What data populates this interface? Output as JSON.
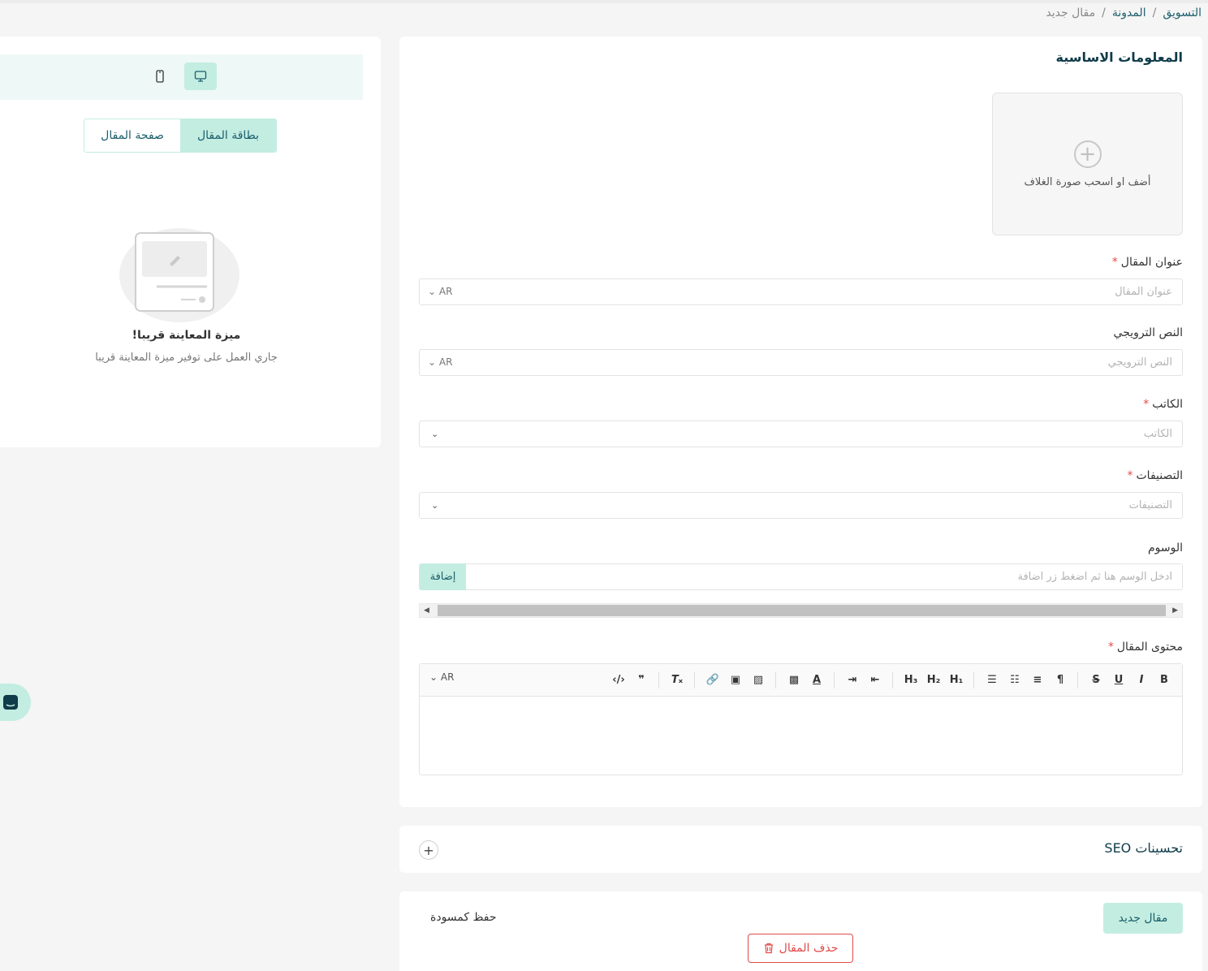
{
  "breadcrumb": {
    "items": [
      "التسويق",
      "المدونة"
    ],
    "separator": "/",
    "current": "مقال جديد"
  },
  "form": {
    "section_title": "المعلومات الاساسية",
    "cover_upload": {
      "label": "أضف او اسحب صورة الغلاف",
      "icon": "plus-circle-icon"
    },
    "title_field": {
      "label": "عنوان المقال",
      "required_mark": "*",
      "placeholder": "عنوان المقال",
      "lang": "AR"
    },
    "promo_field": {
      "label": "النص الترويجي",
      "placeholder": "النص الترويجي",
      "lang": "AR"
    },
    "author_field": {
      "label": "الكاتب",
      "required_mark": "*",
      "placeholder": "الكاتب"
    },
    "categories_field": {
      "label": "التصنيفات",
      "required_mark": "*",
      "placeholder": "التصنيفات"
    },
    "tags_field": {
      "label": "الوسوم",
      "placeholder": "ادخل الوسم هنا ثم اضغط زر اضافة",
      "add_label": "إضافة"
    },
    "content_field": {
      "label": "محتوى المقال",
      "required_mark": "*",
      "lang": "AR",
      "toolbar": [
        "B",
        "I",
        "U",
        "S",
        "¶",
        "≡",
        "1≡",
        "•≡",
        "H1",
        "H2",
        "H3",
        "indent",
        "outdent",
        "A",
        "highlight",
        "image",
        "video",
        "link",
        "Tx",
        "99",
        "</>"
      ]
    }
  },
  "seo": {
    "title": "تحسينات SEO",
    "toggle": "+"
  },
  "actions": {
    "new_article": "مقال جديد",
    "save_draft": "حفظ كمسودة",
    "delete_article": "حذف المقال"
  },
  "preview": {
    "tabs": [
      "بطاقة المقال",
      "صفحة المقال"
    ],
    "active_tab": "بطاقة المقال",
    "devices": [
      "desktop-icon",
      "mobile-icon"
    ],
    "coming_title": "ميزة المعاينة قريبا!",
    "coming_subtitle": "جاري العمل على توفير ميزة المعاينة قريبا"
  },
  "colors": {
    "accent": "#c3ede1",
    "primary_text": "#1b5e6b",
    "danger": "#e24b4b",
    "background": "#f5f5f5"
  }
}
